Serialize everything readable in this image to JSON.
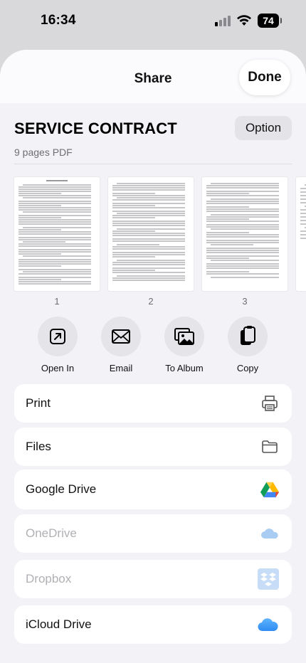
{
  "status": {
    "time": "16:34",
    "battery": "74"
  },
  "sheet": {
    "title": "Share",
    "done_label": "Done"
  },
  "document": {
    "title": "SERVICE CONTRACT",
    "subtitle": "9 pages PDF",
    "option_label": "Option"
  },
  "pages": [
    {
      "number": "1"
    },
    {
      "number": "2"
    },
    {
      "number": "3"
    }
  ],
  "actions": [
    {
      "label": "Open In",
      "icon": "open-in-icon"
    },
    {
      "label": "Email",
      "icon": "envelope-icon"
    },
    {
      "label": "To Album",
      "icon": "photos-icon"
    },
    {
      "label": "Copy",
      "icon": "copy-icon"
    }
  ],
  "rows": [
    {
      "label": "Print",
      "icon": "printer-icon",
      "enabled": true
    },
    {
      "label": "Files",
      "icon": "folder-icon",
      "enabled": true
    },
    {
      "label": "Google Drive",
      "icon": "google-drive-icon",
      "enabled": true
    },
    {
      "label": "OneDrive",
      "icon": "onedrive-icon",
      "enabled": false
    },
    {
      "label": "Dropbox",
      "icon": "dropbox-icon",
      "enabled": false
    },
    {
      "label": "iCloud Drive",
      "icon": "icloud-icon",
      "enabled": true
    }
  ],
  "colors": {
    "icloud": "#2f8cf2",
    "disabled_text": "#b0b0b5",
    "sheet_bg": "#f2f2f7"
  }
}
